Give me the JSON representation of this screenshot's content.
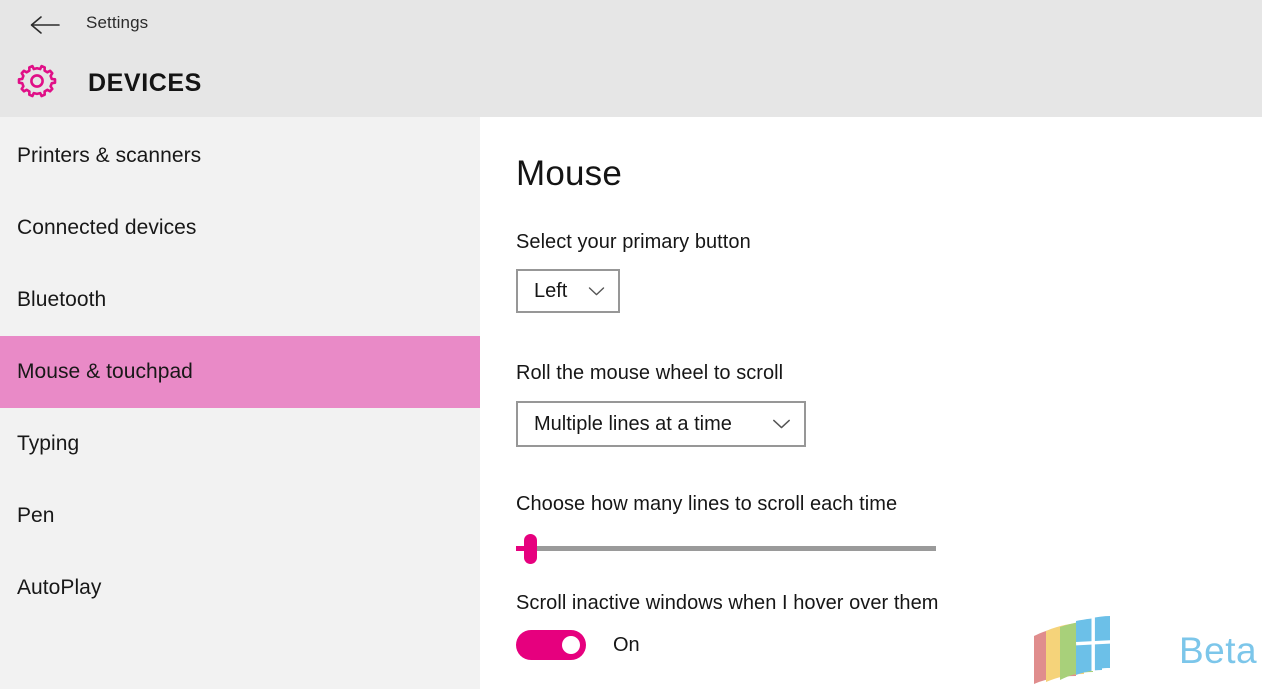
{
  "header": {
    "back_icon": "back-arrow-icon",
    "app_name": "Settings",
    "category_icon": "gear-icon",
    "category_title": "DEVICES",
    "background_color": "#e6e6e6"
  },
  "sidebar": {
    "background_color": "#f2f2f2",
    "selected_background_color": "#e98ac7",
    "items": [
      {
        "label": "Printers & scanners",
        "selected": false
      },
      {
        "label": "Connected devices",
        "selected": false
      },
      {
        "label": "Bluetooth",
        "selected": false
      },
      {
        "label": "Mouse & touchpad",
        "selected": true
      },
      {
        "label": "Typing",
        "selected": false
      },
      {
        "label": "Pen",
        "selected": false
      },
      {
        "label": "AutoPlay",
        "selected": false
      }
    ]
  },
  "main": {
    "heading": "Mouse",
    "accent_color": "#e6007e",
    "primary_button": {
      "label": "Select your primary button",
      "value": "Left",
      "chevron_icon": "chevron-down-icon"
    },
    "wheel_scroll": {
      "label": "Roll the mouse wheel to scroll",
      "value": "Multiple lines at a time",
      "chevron_icon": "chevron-down-icon"
    },
    "lines_slider": {
      "label": "Choose how many lines to scroll each time",
      "value": 3,
      "min": 1,
      "max": 100
    },
    "inactive_scroll": {
      "label": "Scroll inactive windows when I hover over them",
      "state": "On",
      "checked": true
    }
  },
  "watermark": {
    "logo_icon": "windows-flag-logo",
    "text": "Beta",
    "text_color": "#7cc6ea"
  }
}
